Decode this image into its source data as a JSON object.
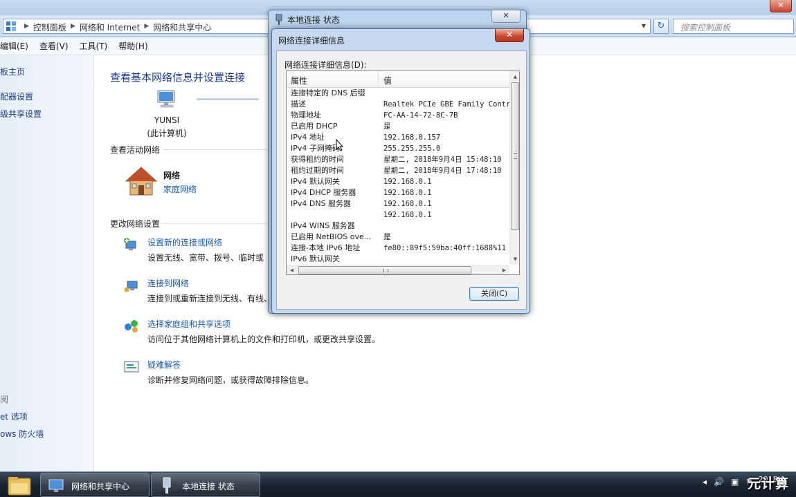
{
  "explorer": {
    "breadcrumbs": [
      "控制面板",
      "网络和 Internet",
      "网络和共享中心"
    ],
    "search_placeholder": "搜索控制面板",
    "menu": [
      "编辑(E)",
      "查看(V)",
      "工具(T)",
      "帮助(H)"
    ],
    "sidebar": {
      "items": [
        "板主页",
        "配器设置",
        "级共享设置"
      ],
      "see_also_head": "阅",
      "see_also": [
        "et 选项",
        "ows 防火墙"
      ]
    },
    "main": {
      "title": "查看基本网络信息并设置连接",
      "computer_name": "YUNSI",
      "computer_sub": "(此计算机)",
      "active_networks_head": "查看活动网络",
      "network_name": "网络",
      "network_type": "家庭网络",
      "change_settings_head": "更改网络设置",
      "tasks": [
        {
          "link": "设置新的连接或网络",
          "desc": "设置无线、宽带、拨号、临时或"
        },
        {
          "link": "连接到网络",
          "desc": "连接到或重新连接到无线、有线、"
        },
        {
          "link": "选择家庭组和共享选项",
          "desc": "访问位于其他网络计算机上的文件和打印机，或更改共享设置。"
        },
        {
          "link": "疑难解答",
          "desc": "诊断并修复网络问题，或获得故障排除信息。"
        }
      ]
    }
  },
  "status_dialog": {
    "title": "本地连接 状态",
    "close_glyph": "✕"
  },
  "details_dialog": {
    "title": "网络连接详细信息",
    "close_glyph": "✕",
    "list_label": "网络连接详细信息(D):",
    "col_property": "属性",
    "col_value": "值",
    "rows": [
      {
        "prop": "连接特定的 DNS 后缀",
        "val": ""
      },
      {
        "prop": "描述",
        "val": "Realtek PCIe GBE Family Contro"
      },
      {
        "prop": "物理地址",
        "val": "FC-AA-14-72-8C-7B"
      },
      {
        "prop": "已启用 DHCP",
        "val": "是"
      },
      {
        "prop": "IPv4 地址",
        "val": "192.168.0.157"
      },
      {
        "prop": "IPv4 子网掩码",
        "val": "255.255.255.0"
      },
      {
        "prop": "获得租约的时间",
        "val": "星期二, 2018年9月4日 15:48:10"
      },
      {
        "prop": "租约过期的时间",
        "val": "星期二, 2018年9月4日 17:48:10"
      },
      {
        "prop": "IPv4 默认网关",
        "val": "192.168.0.1"
      },
      {
        "prop": "IPv4 DHCP 服务器",
        "val": "192.168.0.1"
      },
      {
        "prop": "IPv4 DNS 服务器",
        "val": "192.168.0.1"
      },
      {
        "prop": "",
        "val": "192.168.0.1"
      },
      {
        "prop": "IPv4 WINS 服务器",
        "val": ""
      },
      {
        "prop": "已启用 NetBIOS ove...",
        "val": "是"
      },
      {
        "prop": "连接-本地 IPv6 地址",
        "val": "fe80::89f5:59ba:40ff:1688%11"
      },
      {
        "prop": "IPv6 默认网关",
        "val": ""
      }
    ],
    "close_button": "关闭(C)"
  },
  "taskbar": {
    "buttons": [
      "网络和共享中心",
      "本地连接 状态"
    ],
    "clock_line1": "",
    "clock_line2": "2018/9"
  },
  "watermark": "元计算"
}
